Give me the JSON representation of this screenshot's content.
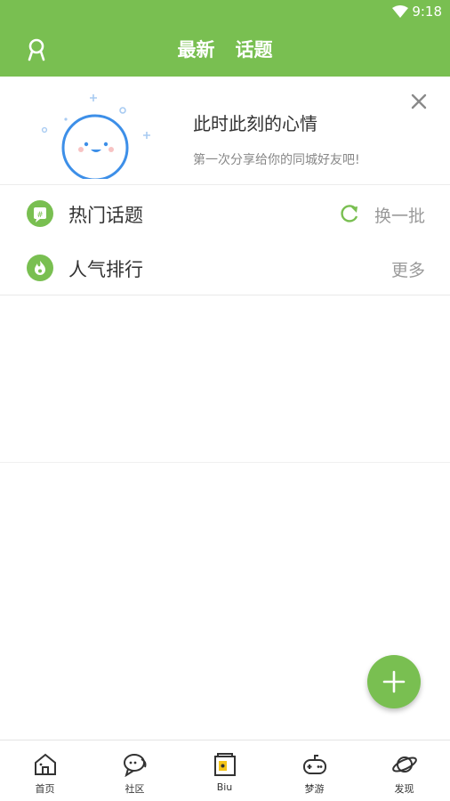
{
  "status_bar": {
    "time": "9:18",
    "wifi_icon": "wifi-icon"
  },
  "header": {
    "profile_icon": "profile-icon",
    "tabs": [
      {
        "label": "最新"
      },
      {
        "label": "话题"
      }
    ],
    "color": "#79bf51"
  },
  "mood_card": {
    "title": "此时此刻的心情",
    "subtitle": "第一次分享给你的同城好友吧!",
    "close_icon": "close-icon",
    "illustration": "smiling-cloud-icon"
  },
  "rows": [
    {
      "label": "热门话题",
      "icon": "topic-hash-icon",
      "action_icon": "refresh-icon",
      "action": "换一批"
    },
    {
      "label": "人气排行",
      "icon": "flame-icon",
      "action": "更多"
    }
  ],
  "fab": {
    "icon": "plus-icon"
  },
  "bottom_nav": [
    {
      "label": "首页",
      "icon": "home-icon"
    },
    {
      "label": "社区",
      "icon": "chat-bubble-icon"
    },
    {
      "label": "Biu",
      "icon": "biu-box-icon"
    },
    {
      "label": "梦游",
      "icon": "gamepad-icon"
    },
    {
      "label": "发现",
      "icon": "planet-icon"
    }
  ],
  "colors": {
    "accent": "#79bf51",
    "text": "#333333",
    "muted": "#9a9a9a"
  }
}
